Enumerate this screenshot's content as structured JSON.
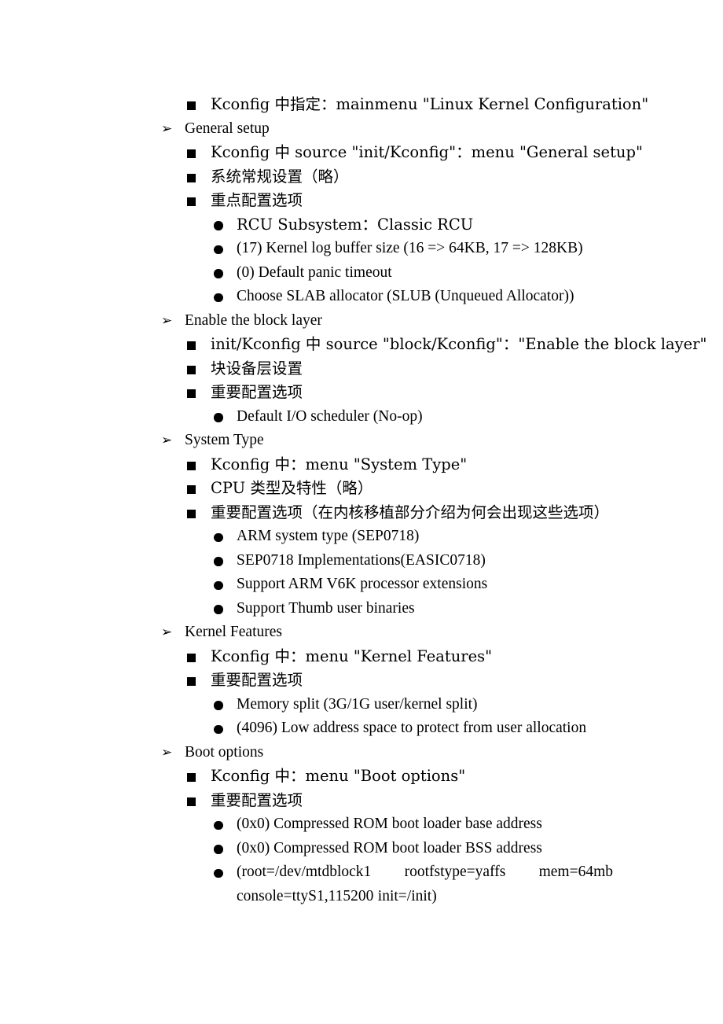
{
  "document": {
    "background_color": "#ffffff",
    "text_color": "#000000",
    "markers": {
      "level1": "arrowhead-marker",
      "level2": "filled-square-marker",
      "level3": "filled-disc-marker"
    },
    "level1_marker_glyph": "➢"
  },
  "outline": {
    "l0_kconfig_mainmenu": "Kconfig 中指定：mainmenu \"Linux Kernel Configuration\"",
    "s1_heading": "General setup",
    "s1_b1": "Kconfig 中 source \"init/Kconfig\"：menu \"General setup\"",
    "s1_b2": "系统常规设置（略）",
    "s1_b3": "重点配置选项",
    "s1_c1": "RCU Subsystem：Classic RCU",
    "s1_c2": "(17) Kernel log buffer size (16 => 64KB, 17 => 128KB)",
    "s1_c3": "(0) Default panic timeout",
    "s1_c4": "Choose SLAB allocator (SLUB (Unqueued Allocator))",
    "s2_heading": "Enable the block layer",
    "s2_b1": "init/Kconfig 中 source \"block/Kconfig\"：\"Enable the block layer\"",
    "s2_b2": "块设备层设置",
    "s2_b3": "重要配置选项",
    "s2_c1": "Default I/O scheduler (No-op)",
    "s3_heading": "System Type",
    "s3_b1": "Kconfig 中：menu \"System Type\"",
    "s3_b2": "CPU 类型及特性（略）",
    "s3_b3": "重要配置选项（在内核移植部分介绍为何会出现这些选项）",
    "s3_c1": "ARM system type (SEP0718)",
    "s3_c2": "SEP0718 Implementations(EASIC0718)",
    "s3_c3": "Support ARM V6K processor extensions",
    "s3_c4": "Support Thumb user binaries",
    "s4_heading": "Kernel Features",
    "s4_b1": "Kconfig 中：menu \"Kernel Features\"",
    "s4_b2": "重要配置选项",
    "s4_c1": "Memory split (3G/1G user/kernel split)",
    "s4_c2": "(4096) Low address space to protect from user allocation",
    "s5_heading": "Boot options",
    "s5_b1": "Kconfig 中：menu \"Boot options\"",
    "s5_b2": "重要配置选项",
    "s5_c1": "(0x0) Compressed ROM boot loader base address",
    "s5_c2": "(0x0) Compressed ROM boot loader BSS address",
    "s5_c3_line1": "(root=/dev/mtdblock1 rootfstype=yaffs mem=64mb",
    "s5_c3_line2": "console=ttyS1,115200 init=/init)"
  }
}
